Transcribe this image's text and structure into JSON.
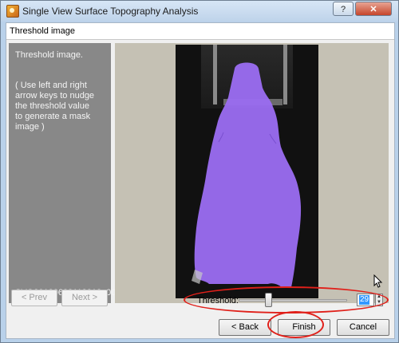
{
  "window": {
    "title": "Single View Surface Topography Analysis",
    "help_label": "?",
    "close_label": "✕"
  },
  "header": {
    "title": "Threshold image"
  },
  "left_panel": {
    "step_title": "Threshold image.",
    "instructions": "( Use left and right\narrow keys to nudge\nthe threshold value\nto generate a mask image )",
    "image_id": "SVO20120628112213_001"
  },
  "threshold": {
    "label": "Threshold:",
    "value": "29",
    "slider_fraction": 0.26
  },
  "nav": {
    "prev_label": "< Prev",
    "next_label": "Next >"
  },
  "footer": {
    "back_label": "< Back",
    "finish_label": "Finish",
    "cancel_label": "Cancel"
  },
  "colors": {
    "mask": "#9a6cf0",
    "annotation": "#e0201a",
    "panel_gray": "#888888"
  }
}
